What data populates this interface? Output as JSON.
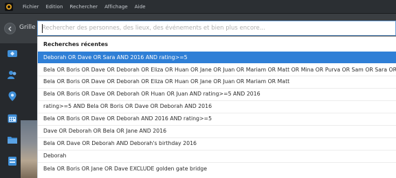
{
  "menubar": {
    "items": [
      "Fichier",
      "Edition",
      "Rechercher",
      "Affichage",
      "Aide"
    ]
  },
  "toolbar": {
    "back_icon": "chevron-left-icon",
    "view_label": "Grille"
  },
  "search": {
    "value": "",
    "placeholder": "Rechercher des personnes, des lieux, des événements et bien plus encore..."
  },
  "sidebar": {
    "icons": [
      "tag-icon",
      "people-icon",
      "location-pin-icon",
      "calendar-icon",
      "folder-icon",
      "album-icon"
    ]
  },
  "dropdown": {
    "header": "Recherches récentes",
    "items": [
      "Deborah OR Dave OR Sara AND 2016 AND rating>=5",
      "Bela OR Boris OR Dave OR Deborah OR Eliza OR Huan OR Jane OR Juan OR Mariam OR Matt OR Mina OR Purva OR Sam OR Sara OR Valeria",
      "Bela OR Boris OR Dave OR Deborah OR Eliza OR Huan OR Jane OR Juan OR Mariam OR Matt",
      "Bela OR Boris OR Dave OR Deborah OR Huan OR Juan AND rating>=5 AND 2016",
      "rating>=5 AND Bela OR Boris OR Dave OR Deborah AND 2016",
      "Bela OR Boris OR Dave OR Deborah AND 2016 AND rating>=5",
      "Dave OR Deborah OR Bela OR Jane AND 2016",
      "Bela OR Dave OR Deborah AND Deborah's birthday 2016",
      "Deborah",
      "Bela OR Boris OR Jane OR Dave EXCLUDE golden gate bridge"
    ],
    "selected_index": 0
  },
  "colors": {
    "accent": "#2f7fd6",
    "menubar_bg": "#2b2f33",
    "toolbar_bg": "#3a3e42",
    "sidebar_icon": "#3f8fd8"
  }
}
